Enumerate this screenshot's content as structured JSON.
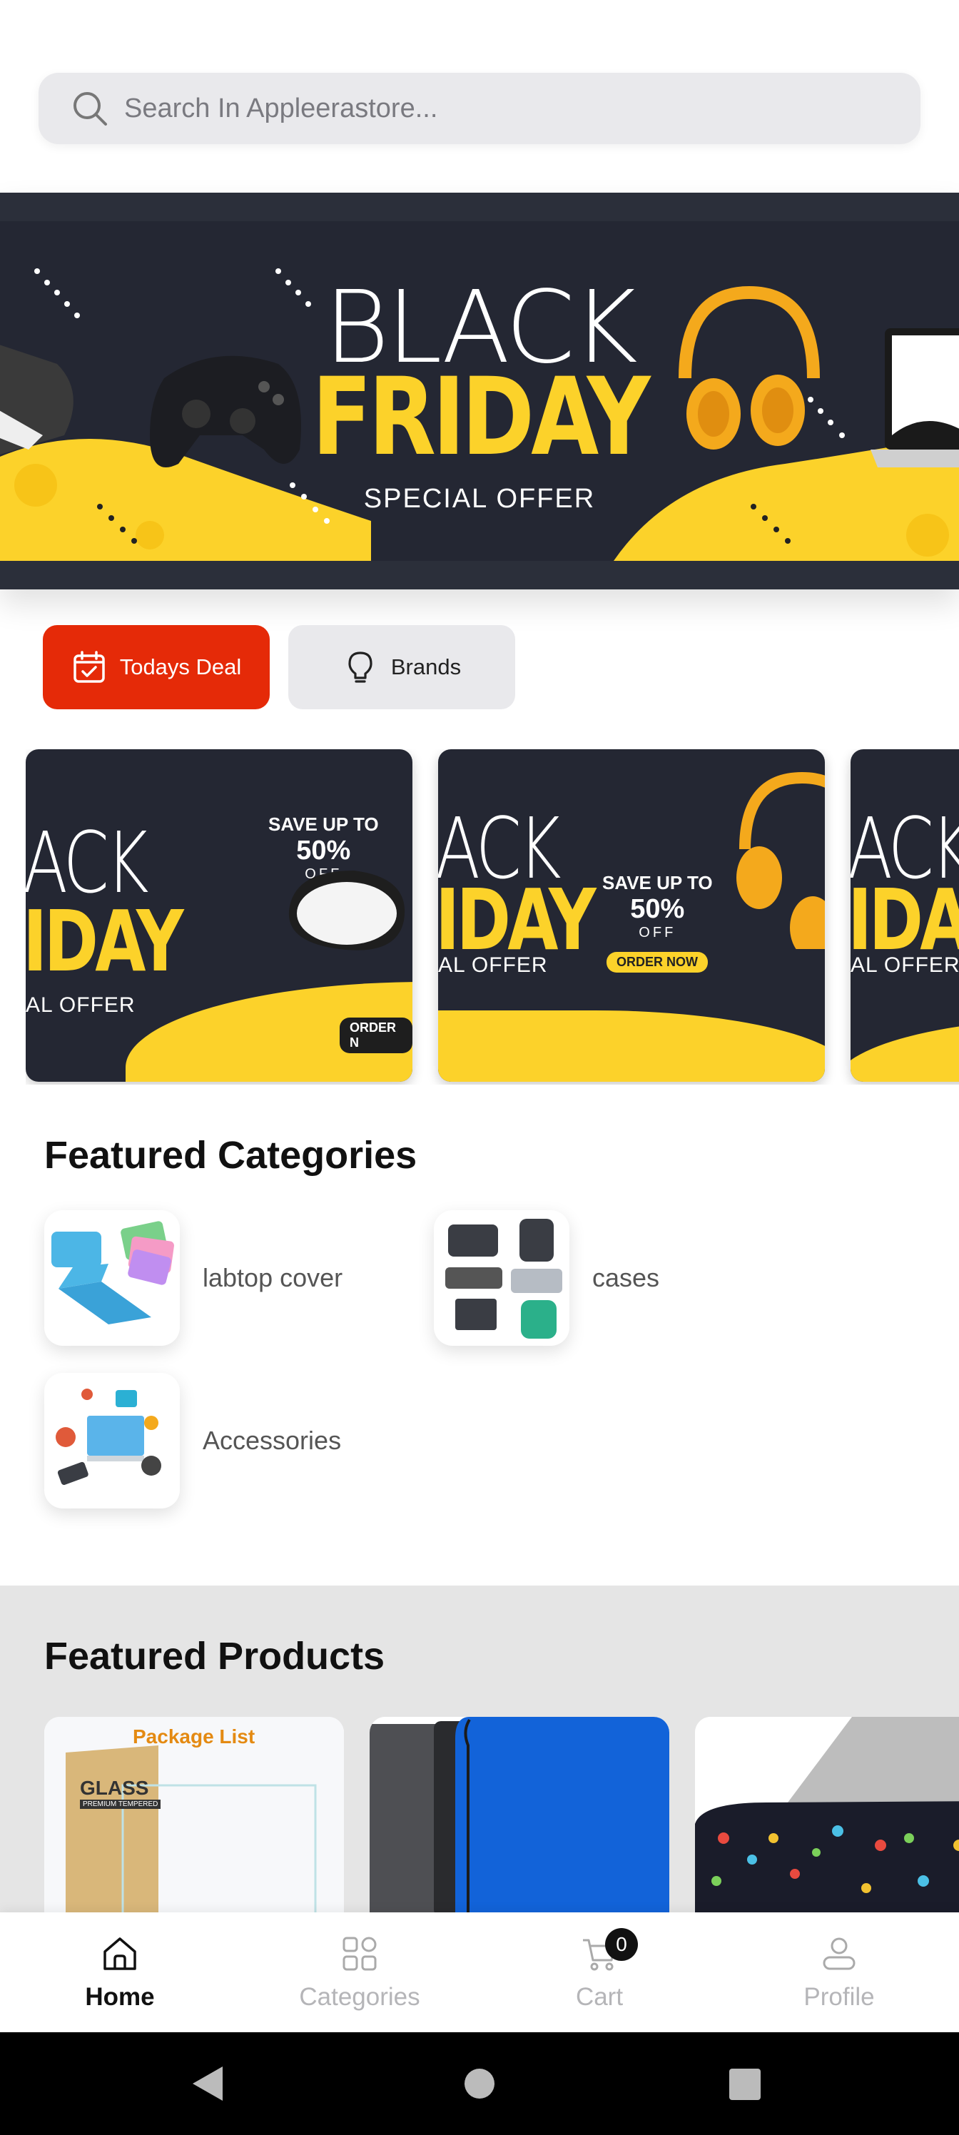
{
  "search": {
    "placeholder": "Search In Appleerastore..."
  },
  "hero": {
    "line1": "BLACK",
    "line2": "FRIDAY",
    "line3": "SPECIAL OFFER"
  },
  "chips": [
    {
      "label": "Todays Deal"
    },
    {
      "label": "Brands"
    }
  ],
  "promos": [
    {
      "big1": "ACK",
      "big2": "IDAY",
      "small": "AL OFFER",
      "save1": "SAVE UP TO",
      "save2": "50%",
      "save3": "OFF",
      "order": "ORDER N"
    },
    {
      "big1": "ACK",
      "big2": "IDAY",
      "small": "AL OFFER",
      "save1": "SAVE UP TO",
      "save2": "50%",
      "save3": "OFF",
      "order": "ORDER NOW"
    },
    {
      "big1": "ACK",
      "big2": "IDA",
      "small": "AL OFFER"
    }
  ],
  "featured_categories": {
    "title": "Featured Categories",
    "items": [
      {
        "label": "labtop cover"
      },
      {
        "label": "cases"
      },
      {
        "label": "Accessories"
      }
    ]
  },
  "featured_products": {
    "title": "Featured Products",
    "first_banner": {
      "top": "Package List",
      "brand": "GLASS",
      "sub": "PREMIUM TEMPERED"
    }
  },
  "bottom_nav": {
    "items": [
      {
        "label": "Home"
      },
      {
        "label": "Categories"
      },
      {
        "label": "Cart",
        "badge": "0"
      },
      {
        "label": "Profile"
      }
    ]
  },
  "colors": {
    "accent": "#e52a08",
    "brand_yellow": "#fcd22a",
    "banner_dark": "#242733"
  }
}
